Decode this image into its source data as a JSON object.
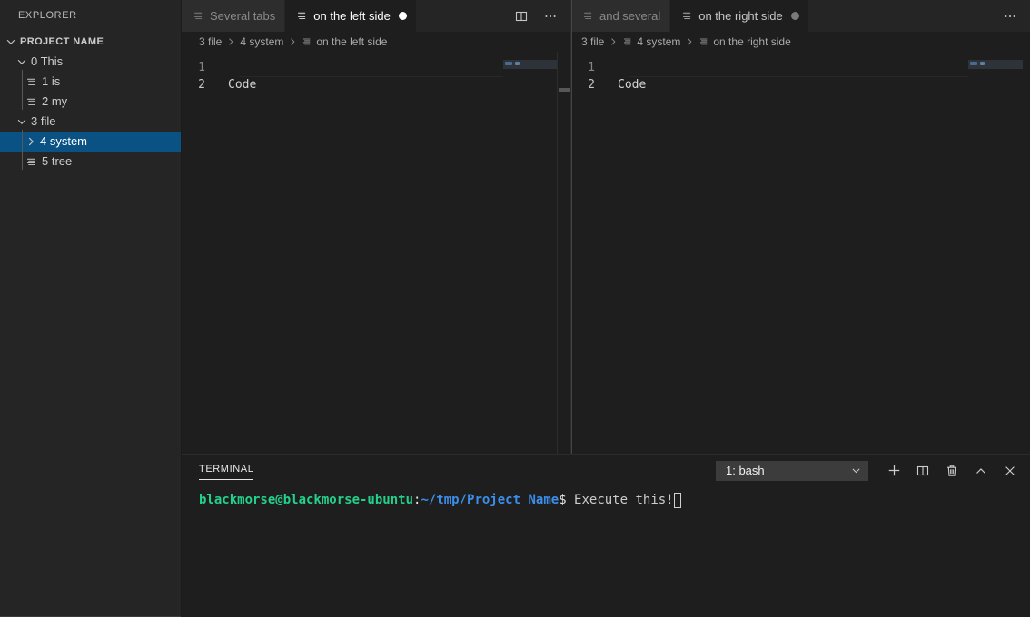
{
  "sidebar": {
    "title": "EXPLORER",
    "tree": [
      {
        "label": "PROJECT NAME",
        "type": "root",
        "expanded": true,
        "depth": 0,
        "icon": "chevron-down-icon"
      },
      {
        "label": "0 This",
        "type": "folder",
        "expanded": true,
        "depth": 1,
        "icon": "chevron-down-icon"
      },
      {
        "label": "1 is",
        "type": "file",
        "depth": 2,
        "icon": "file-lines-icon"
      },
      {
        "label": "2 my",
        "type": "file",
        "depth": 2,
        "icon": "file-lines-icon"
      },
      {
        "label": "3 file",
        "type": "folder",
        "expanded": true,
        "depth": 1,
        "icon": "chevron-down-icon"
      },
      {
        "label": "4 system",
        "type": "folder",
        "expanded": false,
        "depth": 2,
        "icon": "chevron-right-icon",
        "selected": true
      },
      {
        "label": "5 tree",
        "type": "file",
        "depth": 2,
        "icon": "file-lines-icon"
      }
    ]
  },
  "editor_groups": [
    {
      "id": "left",
      "tabs": [
        {
          "label": "Several tabs",
          "active": false,
          "dirty": false,
          "icon": "file-lines-icon"
        },
        {
          "label": "on the left side",
          "active": true,
          "dirty": true,
          "icon": "file-lines-icon"
        }
      ],
      "actions": [
        {
          "name": "split-editor-button",
          "icon": "split-editor-icon"
        },
        {
          "name": "more-actions-button",
          "icon": "ellipsis-icon"
        }
      ],
      "breadcrumbs": [
        {
          "label": "3 file",
          "icon": null
        },
        {
          "label": "4 system",
          "icon": null
        },
        {
          "label": "on the left side",
          "icon": "file-lines-icon"
        }
      ],
      "code": {
        "lines": [
          {
            "number": "1",
            "text": "",
            "current": false
          },
          {
            "number": "2",
            "text": "Code",
            "current": true
          }
        ]
      }
    },
    {
      "id": "right",
      "tabs": [
        {
          "label": "and several",
          "active": false,
          "dirty": false,
          "icon": "file-lines-icon"
        },
        {
          "label": "on the right side",
          "active": true,
          "dirty": true,
          "icon": "file-lines-icon"
        }
      ],
      "actions": [
        {
          "name": "more-actions-button",
          "icon": "ellipsis-icon"
        }
      ],
      "breadcrumbs": [
        {
          "label": "3 file",
          "icon": null
        },
        {
          "label": "4 system",
          "icon": "file-lines-icon"
        },
        {
          "label": "on the right side",
          "icon": "file-lines-icon"
        }
      ],
      "code": {
        "lines": [
          {
            "number": "1",
            "text": "",
            "current": false
          },
          {
            "number": "2",
            "text": "Code",
            "current": true
          }
        ]
      }
    }
  ],
  "panel": {
    "tab_label": "TERMINAL",
    "terminal_select": {
      "value": "1: bash",
      "chevron": "chevron-down-icon"
    },
    "actions": [
      {
        "name": "new-terminal-button",
        "icon": "plus-icon"
      },
      {
        "name": "split-terminal-button",
        "icon": "split-editor-icon"
      },
      {
        "name": "kill-terminal-button",
        "icon": "trash-icon"
      },
      {
        "name": "maximize-panel-button",
        "icon": "chevron-up-icon"
      },
      {
        "name": "close-panel-button",
        "icon": "close-icon"
      }
    ],
    "terminal": {
      "user_host": "blackmorse@blackmorse-ubuntu",
      "separator": ":",
      "path": "~/tmp/Project Name",
      "prompt_symbol": "$",
      "command": " Execute this!"
    }
  },
  "colors": {
    "sidebar_bg": "#252526",
    "editor_bg": "#1e1e1e",
    "tab_inactive_bg": "#2d2d2d",
    "selection_blue": "#0a5184",
    "terminal_green": "#23d18b",
    "terminal_blue": "#3b8eea",
    "accent_white": "#ffffff"
  }
}
